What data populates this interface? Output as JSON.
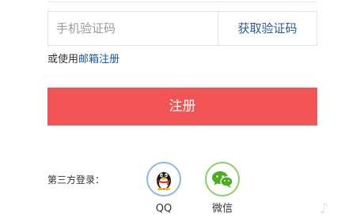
{
  "sms": {
    "placeholder": "手机验证码",
    "get_code_label": "获取验证码"
  },
  "alt_register": {
    "prefix": "或使用",
    "email_link": "邮箱注册"
  },
  "register": {
    "label": "注册",
    "color": "#f05454"
  },
  "third_party": {
    "label": "第三方登录：",
    "providers": [
      {
        "name": "QQ",
        "icon": "qq-penguin-icon",
        "ring_color": "#8fb7e3"
      },
      {
        "name": "微信",
        "icon": "wechat-icon",
        "ring_color": "#8ccf6a"
      }
    ]
  },
  "colors": {
    "link": "#2c5aa0",
    "border": "#e3e3e3"
  }
}
